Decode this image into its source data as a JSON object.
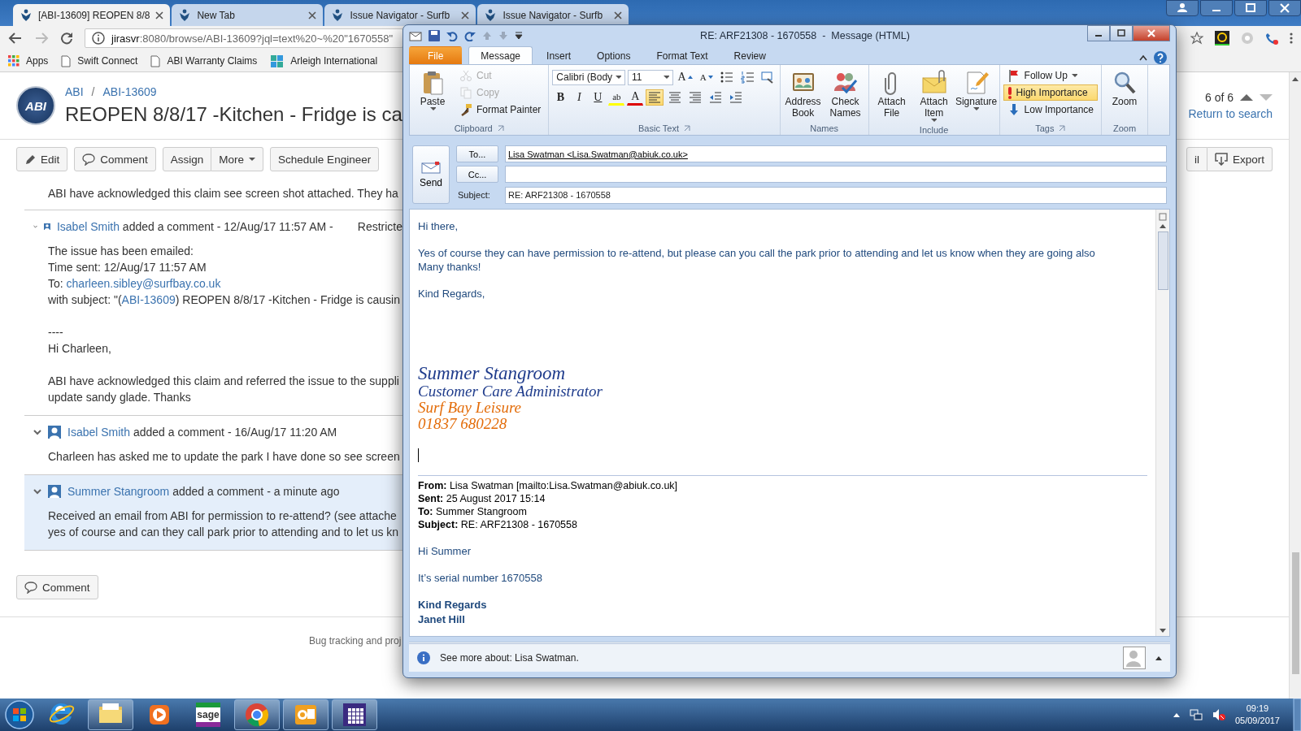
{
  "browser": {
    "tabs": [
      {
        "title": "[ABI-13609] REOPEN 8/8",
        "selected": true
      },
      {
        "title": "New Tab",
        "selected": false
      },
      {
        "title": "Issue Navigator - Surfb",
        "selected": false
      },
      {
        "title": "Issue Navigator - Surfb",
        "selected": false
      }
    ],
    "address": "jirasvr:8080/browse/ABI-13609?jql=text%20~%20\"1670558\"",
    "bookmarks": [
      {
        "label": "Apps",
        "kind": "apps"
      },
      {
        "label": "Swift Connect",
        "kind": "page"
      },
      {
        "label": "ABI Warranty Claims",
        "kind": "page"
      },
      {
        "label": "Arleigh International",
        "kind": "site"
      }
    ]
  },
  "issue": {
    "logo_text": "ABI",
    "breadcrumb": [
      "ABI",
      "ABI-13609"
    ],
    "breadcrumb_separator": "/",
    "title": "REOPEN 8/8/17 -Kitchen - Fridge is ca",
    "pager": "6 of 6",
    "return_link": "Return to search",
    "toolbar": [
      {
        "label": "Edit",
        "kind": "edit"
      },
      {
        "label": "Comment",
        "kind": "comment"
      },
      {
        "label": "Assign",
        "kind": "plain"
      },
      {
        "label": "More",
        "kind": "dropdown"
      },
      {
        "label": "Schedule Engineer",
        "kind": "plain"
      }
    ],
    "toolbar_right": [
      {
        "label": "il",
        "kind": "plain"
      },
      {
        "label": "Export",
        "kind": "export"
      }
    ],
    "intro_text": "ABI have acknowledged this claim see screen shot attached. They ha",
    "comments": [
      {
        "author": "Isabel Smith",
        "meta": " added a comment - 12/Aug/17 11:57 AM -",
        "restriction": "Restricte",
        "highlighted": false,
        "paragraphs": [
          [
            "The issue has been emailed:",
            "Time sent: 12/Aug/17 11:57 AM",
            {
              "text": "To: ",
              "link": "charleen.sibley@surfbay.co.uk"
            },
            {
              "text": "with subject: \"(",
              "link": "ABI-13609",
              "after": ") REOPEN 8/8/17 -Kitchen - Fridge is causin"
            }
          ],
          [
            "----",
            "Hi Charleen,"
          ],
          [
            "ABI have acknowledged this claim and referred the issue to the suppli",
            "update sandy glade. Thanks"
          ]
        ]
      },
      {
        "author": "Isabel Smith",
        "meta": " added a comment - 16/Aug/17 11:20 AM",
        "highlighted": false,
        "paragraphs": [
          [
            "Charleen has asked me to update the park I have done so see screen"
          ]
        ]
      },
      {
        "author": "Summer Stangroom",
        "meta": " added a comment - a minute ago",
        "highlighted": true,
        "paragraphs": [
          [
            "Received an email from ABI for permission to re-attend? (see attache",
            "yes of course and can they call park prior to attending and to let us kn"
          ]
        ]
      }
    ],
    "comment_button": "Comment",
    "footer": "Bug tracking and proj"
  },
  "outlook": {
    "title": "RE: ARF21308 - 1670558  -  Message (HTML)",
    "ribbon_tabs": [
      {
        "label": "File",
        "kind": "file",
        "selected": false
      },
      {
        "label": "Message",
        "kind": "tab",
        "selected": true
      },
      {
        "label": "Insert",
        "kind": "tab",
        "selected": false
      },
      {
        "label": "Options",
        "kind": "tab",
        "selected": false
      },
      {
        "label": "Format Text",
        "kind": "tab",
        "selected": false
      },
      {
        "label": "Review",
        "kind": "tab",
        "selected": false
      }
    ],
    "groups": [
      {
        "label": "Clipboard",
        "kind": "items",
        "items": [
          {
            "label": "Paste",
            "kind": "paste",
            "disabled": false
          },
          {
            "label": "Cut",
            "kind": "cut",
            "disabled": true
          },
          {
            "label": "Copy",
            "kind": "copy",
            "disabled": true
          },
          {
            "label": "Format Painter",
            "kind": "painter",
            "disabled": false
          }
        ]
      },
      {
        "label": "Basic Text",
        "kind": "text",
        "font": "Calibri (Body",
        "size": "11",
        "row1": [
          {
            "label": "A",
            "kind": "grow"
          },
          {
            "label": "A",
            "kind": "shrink"
          },
          {
            "kind": "bullets"
          },
          {
            "kind": "numbering"
          },
          {
            "kind": "styles"
          }
        ],
        "row2": [
          {
            "label": "B",
            "kind": "bold",
            "on": false
          },
          {
            "label": "I",
            "kind": "italic",
            "on": false
          },
          {
            "label": "U",
            "kind": "underline",
            "on": false
          },
          {
            "label": "ab",
            "kind": "highlight",
            "on": false
          },
          {
            "label": "A",
            "kind": "fontcolor",
            "on": false
          },
          {
            "kind": "alignleft",
            "on": true
          },
          {
            "kind": "aligncenter",
            "on": false
          },
          {
            "kind": "alignright",
            "on": false
          },
          {
            "kind": "outdent",
            "on": false
          },
          {
            "kind": "indent",
            "on": false
          }
        ]
      },
      {
        "label": "Names",
        "kind": "items",
        "items": [
          {
            "label": "Address Book",
            "kind": "addressbook"
          },
          {
            "label": "Check Names",
            "kind": "checknames"
          }
        ]
      },
      {
        "label": "Include",
        "kind": "items",
        "items": [
          {
            "label": "Attach File",
            "kind": "attach"
          },
          {
            "label": "Attach Item",
            "kind": "attachitem"
          },
          {
            "label": "Signature",
            "kind": "signature"
          }
        ]
      },
      {
        "label": "Tags",
        "kind": "items",
        "items": [
          {
            "label": "Follow Up",
            "kind": "followup",
            "on": false
          },
          {
            "label": "High Importance",
            "kind": "high",
            "on": true
          },
          {
            "label": "Low Importance",
            "kind": "low",
            "on": false
          }
        ]
      },
      {
        "label": "Zoom",
        "kind": "items",
        "items": [
          {
            "label": "Zoom",
            "kind": "zoom"
          }
        ]
      }
    ],
    "compose": {
      "send": "Send",
      "to_button": "To...",
      "cc_button": "Cc...",
      "subject_label": "Subject:",
      "to_value": "Lisa Swatman <Lisa.Swatman@abiuk.co.uk>",
      "subject_value": "RE: ARF21308 - 1670558"
    },
    "body": {
      "greeting": "Hi there,",
      "paragraph": [
        "Yes of course they can have permission to re-attend, but please can you call the park prior to attending and let us know when they are going also",
        "Many thanks!"
      ],
      "closing": "Kind Regards,",
      "signature": [
        {
          "text": "Summer Stangroom",
          "kind": "name"
        },
        {
          "text": "Customer Care Administrator",
          "kind": "role"
        },
        {
          "text": "Surf Bay Leisure",
          "kind": "company"
        },
        {
          "text": "01837 680228",
          "kind": "phone"
        }
      ],
      "quoted_header": [
        {
          "label": "From:",
          "value": "Lisa Swatman [mailto:Lisa.Swatman@abiuk.co.uk]"
        },
        {
          "label": "Sent:",
          "value": "25 August 2017 15:14"
        },
        {
          "label": "To:",
          "value": "Summer Stangroom"
        },
        {
          "label": "Subject:",
          "value": "RE: ARF21308 - 1670558"
        }
      ],
      "quoted_body": [
        "Hi Summer",
        "It’s serial number 1670558"
      ],
      "quoted_signature": [
        "Kind Regards",
        "Janet Hill"
      ]
    },
    "people_pane": "See more about: Lisa Swatman."
  },
  "taskbar": {
    "items": [
      {
        "kind": "ie",
        "running": false
      },
      {
        "kind": "explorer",
        "running": true
      },
      {
        "kind": "media",
        "running": false
      },
      {
        "kind": "sage",
        "label": "sage",
        "running": false
      },
      {
        "kind": "chrome",
        "running": true
      },
      {
        "kind": "outlook",
        "running": true
      },
      {
        "kind": "grid",
        "running": true
      }
    ],
    "time": "09:19",
    "date": "05/09/2017"
  }
}
